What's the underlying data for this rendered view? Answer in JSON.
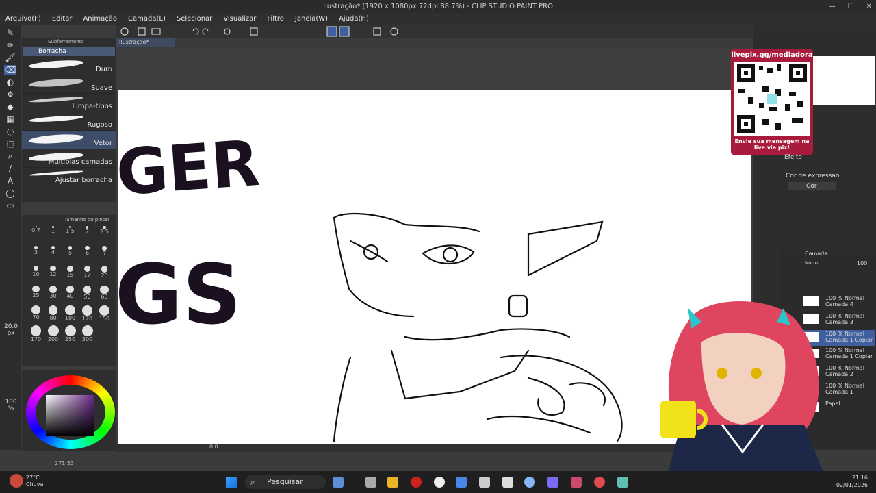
{
  "window": {
    "title": "Ilustração* (1920 x 1080px 72dpi 88.7%) - CLIP STUDIO PAINT PRO",
    "controls": [
      "—",
      "☐",
      "✕"
    ]
  },
  "menu": [
    "Arquivo(F)",
    "Editar",
    "Animação",
    "Camada(L)",
    "Selecionar",
    "Visualizar",
    "Filtro",
    "Janela(W)",
    "Ajuda(H)"
  ],
  "canvas_tab": "Ilustração*",
  "subtool": {
    "header": "Subferramenta",
    "group": "Borracha",
    "items": [
      {
        "label": "Duro"
      },
      {
        "label": "Suave"
      },
      {
        "label": "Limpa-tipos"
      },
      {
        "label": "Rugoso"
      },
      {
        "label": "Vetor"
      },
      {
        "label": "Múltiplas camadas"
      },
      {
        "label": "Ajustar borracha"
      }
    ],
    "selected": "Vetor"
  },
  "brush_size": {
    "header": "Tamanho do pincel",
    "sizes": [
      "0.7",
      "1",
      "1.5",
      "2",
      "2.5",
      "3",
      "4",
      "5",
      "6",
      "7",
      "10",
      "12",
      "15",
      "17",
      "20",
      "25",
      "30",
      "40",
      "50",
      "60",
      "70",
      "80",
      "100",
      "120",
      "150",
      "170",
      "200",
      "250",
      "300"
    ],
    "current": "20.0",
    "unit": "px",
    "opacity": "100",
    "opacity_unit": "%"
  },
  "canvas_art": {
    "text_top": "GER",
    "text_bottom": "GS"
  },
  "status": {
    "angle": "0.0",
    "readout": "271 53"
  },
  "overlay": {
    "qr_title": "livepix.gg/mediadora",
    "qr_message": "Envie sua mensagem na live via pix!"
  },
  "effect_panel": {
    "effect_label": "Efeito",
    "color_expression_label": "Cor de expressão",
    "color_expression_value": "Cor"
  },
  "layers": {
    "title": "Camada",
    "blend": "Norm",
    "opacity": "100",
    "items": [
      {
        "pct": "100 %",
        "mode": "Normal",
        "name": "Camada 4"
      },
      {
        "pct": "100 %",
        "mode": "Normal",
        "name": "Camada 3"
      },
      {
        "pct": "100 %",
        "mode": "Normal",
        "name": "Camada 1 Copiar"
      },
      {
        "pct": "100 %",
        "mode": "Normal",
        "name": "Camada 1 Copiar"
      },
      {
        "pct": "100 %",
        "mode": "Normal",
        "name": "Camada 2"
      },
      {
        "pct": "100 %",
        "mode": "Normal",
        "name": "Camada 1"
      },
      {
        "pct": "",
        "mode": "",
        "name": "Papel"
      }
    ]
  },
  "taskbar": {
    "weather_temp": "27°C",
    "weather_desc": "Chuva",
    "search_placeholder": "Pesquisar",
    "time": "21:16",
    "date": "02/01/2026"
  },
  "colors": {
    "accent": "#4a5a78",
    "qr_bg": "#a91b3c",
    "canvas": "#ffffff",
    "ink": "#1a1020"
  }
}
